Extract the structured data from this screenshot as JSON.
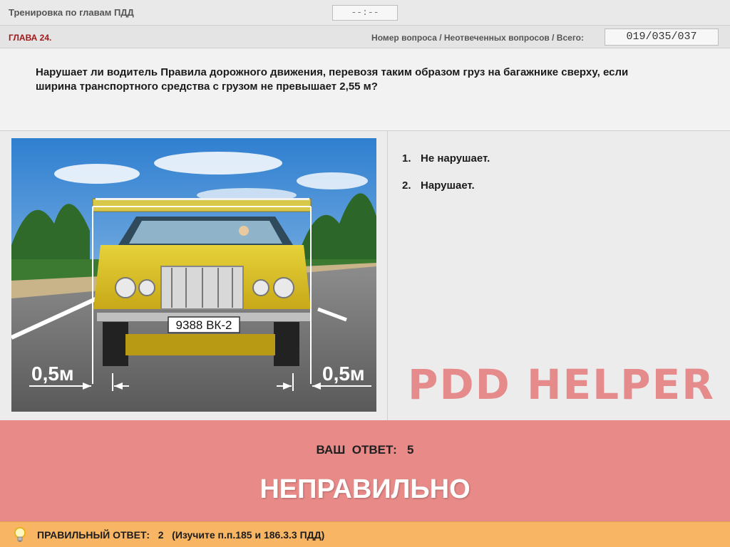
{
  "header": {
    "title": "Тренировка по главам ПДД",
    "timer": "--:--"
  },
  "chapter_bar": {
    "chapter": "ГЛАВА 24.",
    "counter_label": "Номер вопроса / Неотвеченных вопросов / Всего:",
    "counter_value": "019/035/037"
  },
  "question": {
    "text": "Нарушает ли водитель Правила дорожного движения, перевозя таким образом груз на багажнике сверху, если ширина транспортного средства с грузом не превышает 2,55 м?"
  },
  "illustration": {
    "plate": "9388 ВК-2",
    "left_dim": "0,5м",
    "right_dim": "0,5м"
  },
  "answers": [
    {
      "num": "1.",
      "text": "Не нарушает."
    },
    {
      "num": "2.",
      "text": "Нарушает."
    }
  ],
  "watermark": "PDD HELPER",
  "result": {
    "your_answer": "ВАШ  ОТВЕТ:   5",
    "verdict": "НЕПРАВИЛЬНО",
    "bg_color": "#e88a88"
  },
  "hint": {
    "icon": "lightbulb-icon",
    "text": "ПРАВИЛЬНЫЙ ОТВЕТ:   2   (Изучите п.п.185 и 186.3.3 ПДД)",
    "bg_color": "#f8b564"
  }
}
